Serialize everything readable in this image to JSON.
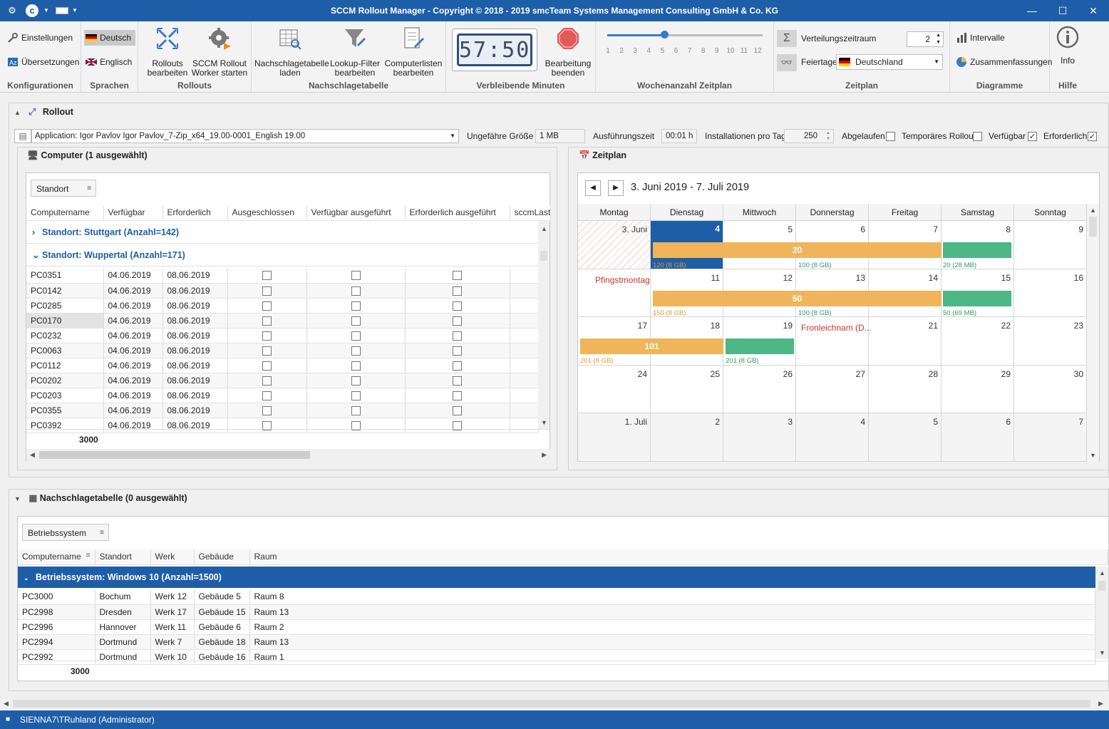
{
  "window": {
    "title": "SCCM Rollout Manager - Copyright © 2018 - 2019 smcTeam Systems Management Consulting GmbH & Co. KG",
    "controls": {
      "minimize": "—",
      "maximize": "☐",
      "close": "✕"
    }
  },
  "ribbon": {
    "konfig": {
      "label": "Konfigurationen",
      "settings": "Einstellungen",
      "translations": "Übersetzungen"
    },
    "sprachen": {
      "label": "Sprachen",
      "de": "Deutsch",
      "en": "Englisch"
    },
    "rollouts": {
      "label": "Rollouts",
      "edit": "Rollouts\nbearbeiten",
      "worker": "SCCM Rollout\nWorker starten"
    },
    "lookup": {
      "label": "Nachschlagetabelle",
      "load": "Nachschlagetabelle\nladen",
      "filter": "Lookup-Filter\nbearbeiten",
      "lists": "Computerlisten\nbearbeiten"
    },
    "minutes": {
      "label": "Verbleibende Minuten",
      "display": "57:50",
      "stop": "Bearbeitung\nbeenden"
    },
    "weeks": {
      "label": "Wochenanzahl Zeitplan",
      "ticks": [
        "1",
        "2",
        "3",
        "4",
        "5",
        "6",
        "7",
        "8",
        "9",
        "10",
        "11",
        "12"
      ],
      "value": 5
    },
    "plan": {
      "label": "Zeitplan",
      "period_label": "Verteilungszeitraum",
      "period_value": "2",
      "holidays_label": "Feiertage",
      "holidays_value": "Deutschland"
    },
    "charts": {
      "label": "Diagramme",
      "intervals": "Intervalle",
      "summaries": "Zusammenfassungen"
    },
    "help": {
      "label": "Hilfe",
      "info": "Info"
    }
  },
  "rollout": {
    "title": "Rollout",
    "application": "Application: Igor Pavlov Igor Pavlov_7-Zip_x64_19.00-0001_English 19.00",
    "size_label": "Ungefähre Größe",
    "size_value": "1 MB",
    "exec_label": "Ausführungszeit",
    "exec_value": "00:01 h",
    "per_day_label": "Installationen pro Tag",
    "per_day_value": "250",
    "expired_label": "Abgelaufen",
    "temp_label": "Temporäres Rollout",
    "avail_label": "Verfügbar",
    "req_label": "Erforderlich",
    "expired": false,
    "temp": false,
    "avail": true,
    "req": true
  },
  "computer": {
    "title": "Computer (1 ausgewählt)",
    "group_chip": "Standort",
    "columns": [
      "Computername",
      "Verfügbar",
      "Erforderlich",
      "Ausgeschlossen",
      "Verfügbar ausgeführt",
      "Erforderlich ausgeführt",
      "sccmLastC"
    ],
    "groups": [
      "Standort: Stuttgart (Anzahl=142)",
      "Standort: Wuppertal (Anzahl=171)"
    ],
    "rows": [
      [
        "PC0351",
        "04.06.2019",
        "08.06.2019"
      ],
      [
        "PC0142",
        "04.06.2019",
        "08.06.2019"
      ],
      [
        "PC0285",
        "04.06.2019",
        "08.06.2019"
      ],
      [
        "PC0170",
        "04.06.2019",
        "08.06.2019"
      ],
      [
        "PC0232",
        "04.06.2019",
        "08.06.2019"
      ],
      [
        "PC0063",
        "04.06.2019",
        "08.06.2019"
      ],
      [
        "PC0112",
        "04.06.2019",
        "08.06.2019"
      ],
      [
        "PC0202",
        "04.06.2019",
        "08.06.2019"
      ],
      [
        "PC0203",
        "04.06.2019",
        "08.06.2019"
      ],
      [
        "PC0355",
        "04.06.2019",
        "08.06.2019"
      ],
      [
        "PC0392",
        "04.06.2019",
        "08.06.2019"
      ]
    ],
    "total": "3000"
  },
  "zeitplan": {
    "title": "Zeitplan",
    "range": "3. Juni 2019 - 7. Juli 2019",
    "days": [
      "Montag",
      "Dienstag",
      "Mittwoch",
      "Donnerstag",
      "Freitag",
      "Samstag",
      "Sonntag"
    ],
    "weeks": [
      [
        "3. Juni",
        "4",
        "5",
        "6",
        "7",
        "8",
        "9"
      ],
      [
        "",
        "11",
        "12",
        "13",
        "14",
        "15",
        "16"
      ],
      [
        "17",
        "18",
        "19",
        "",
        "21",
        "22",
        "23"
      ],
      [
        "24",
        "25",
        "26",
        "27",
        "28",
        "29",
        "30"
      ],
      [
        "1. Juli",
        "2",
        "3",
        "4",
        "5",
        "6",
        "7"
      ]
    ],
    "holidays": {
      "pfingst": "Pfingstmontag",
      "fronleichnam": "Fronleichnam (D..."
    },
    "bars": {
      "w1o": "20",
      "w2o": "50",
      "w3o": "101"
    },
    "subs": {
      "w1a": "120 (8 GB)",
      "w1b": "100 (8 GB)",
      "w1c": "20 (28 MB)",
      "w2a": "150 (8 GB)",
      "w2b": "100 (8 GB)",
      "w2c": "50 (69 MB)",
      "w3a": "201 (8 GB)",
      "w3b": "201 (8 GB)"
    }
  },
  "lookup": {
    "title": "Nachschlagetabelle (0 ausgewählt)",
    "group_chip": "Betriebssystem",
    "columns": [
      "Computername",
      "Standort",
      "Werk",
      "Gebäude",
      "Raum"
    ],
    "group": "Betriebssystem: Windows 10 (Anzahl=1500)",
    "rows": [
      [
        "PC3000",
        "Bochum",
        "Werk 12",
        "Gebäude 5",
        "Raum 8"
      ],
      [
        "PC2998",
        "Dresden",
        "Werk 17",
        "Gebäude 15",
        "Raum 13"
      ],
      [
        "PC2996",
        "Hannover",
        "Werk 11",
        "Gebäude 6",
        "Raum 2"
      ],
      [
        "PC2994",
        "Dortmund",
        "Werk 7",
        "Gebäude 18",
        "Raum 13"
      ],
      [
        "PC2992",
        "Dortmund",
        "Werk 10",
        "Gebäude 16",
        "Raum 1"
      ]
    ],
    "total": "3000"
  },
  "status": {
    "user": "SIENNA7\\TRuhland (Administrator)"
  },
  "colors": {
    "accent": "#1e5ea8",
    "orange": "#f0b55a",
    "green": "#4db785"
  }
}
